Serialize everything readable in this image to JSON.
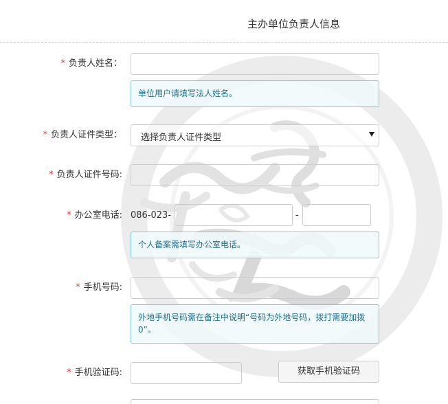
{
  "section": {
    "title": "主办单位负责人信息"
  },
  "required_mark": "*",
  "fields": {
    "name": {
      "label": "负责人姓名：",
      "value": "",
      "hint": "单位用户请填写法人姓名。"
    },
    "id_type": {
      "label": "负责人证件类型：",
      "selected": "选择负责人证件类型"
    },
    "id_number": {
      "label": "负责人证件号码:",
      "value": ""
    },
    "office_phone": {
      "label": "办公室电话:",
      "prefix": "086-023-",
      "separator": "-",
      "number_value": "",
      "extension_value": "",
      "hint": "个人备案需填写办公室电话。"
    },
    "mobile": {
      "label": "手机号码:",
      "value": "",
      "hint": "外地手机号码需在备注中说明“号码为外地号码，拨打需要加拨0”。"
    },
    "sms_code": {
      "label": "手机验证码:",
      "value": "",
      "button": "获取手机验证码"
    }
  },
  "colors": {
    "required": "#e53935",
    "hint_border": "#7ac6dc",
    "hint_text": "#1f6f8b",
    "border": "#cccccc"
  },
  "icons": {
    "select_arrow": "caret-down-icon",
    "watermark": "calligraphy-seal-watermark"
  }
}
